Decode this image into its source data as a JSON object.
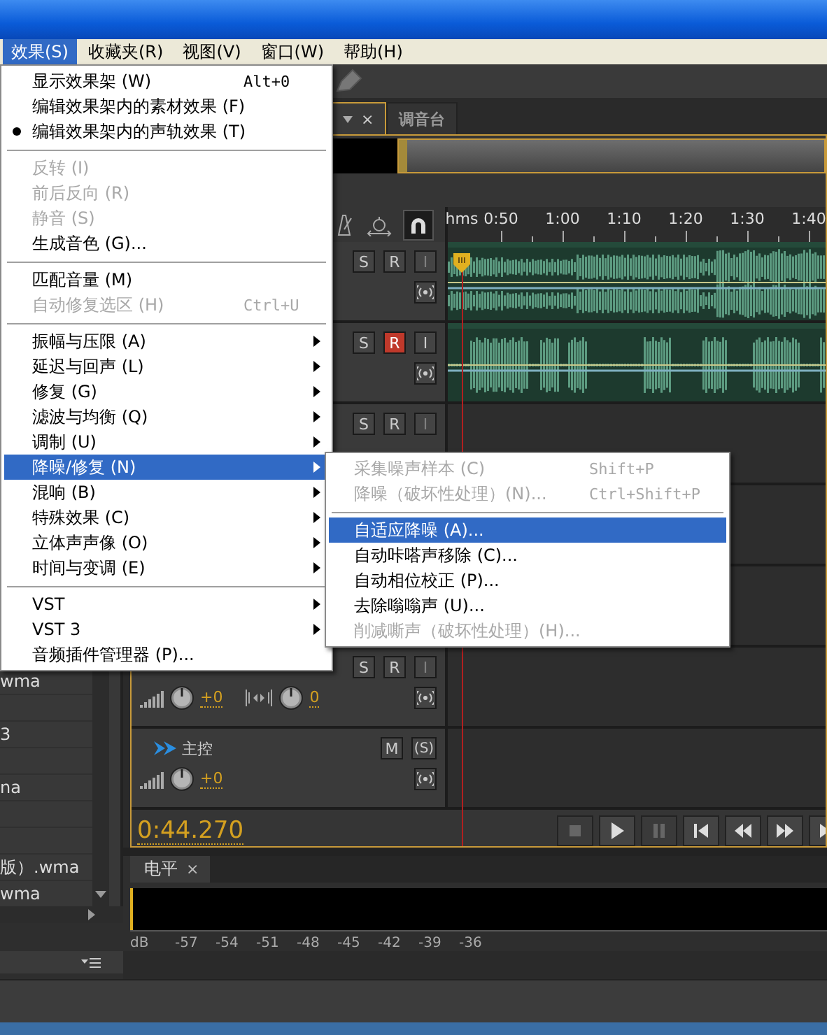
{
  "menubar": [
    {
      "label": "效果(S)",
      "selected": true
    },
    {
      "label": "收藏夹(R)",
      "selected": false
    },
    {
      "label": "视图(V)",
      "selected": false
    },
    {
      "label": "窗口(W)",
      "selected": false
    },
    {
      "label": "帮助(H)",
      "selected": false
    }
  ],
  "effects_menu": {
    "items": [
      {
        "kind": "item",
        "label": "显示效果架 (W)",
        "shortcut": "Alt+0",
        "checked": false,
        "disabled": false,
        "submenu": false,
        "selected": false
      },
      {
        "kind": "item",
        "label": "编辑效果架内的素材效果 (F)",
        "checked": false,
        "disabled": false,
        "submenu": false,
        "selected": false
      },
      {
        "kind": "item",
        "label": "编辑效果架内的声轨效果 (T)",
        "checked": true,
        "disabled": false,
        "submenu": false,
        "selected": false
      },
      {
        "kind": "separator"
      },
      {
        "kind": "item",
        "label": "反转 (I)",
        "checked": false,
        "disabled": true,
        "submenu": false,
        "selected": false
      },
      {
        "kind": "item",
        "label": "前后反向 (R)",
        "checked": false,
        "disabled": true,
        "submenu": false,
        "selected": false
      },
      {
        "kind": "item",
        "label": "静音 (S)",
        "checked": false,
        "disabled": true,
        "submenu": false,
        "selected": false
      },
      {
        "kind": "item",
        "label": "生成音色 (G)...",
        "checked": false,
        "disabled": false,
        "submenu": false,
        "selected": false
      },
      {
        "kind": "separator"
      },
      {
        "kind": "item",
        "label": "匹配音量 (M)",
        "checked": false,
        "disabled": false,
        "submenu": false,
        "selected": false
      },
      {
        "kind": "item",
        "label": "自动修复选区 (H)",
        "shortcut": "Ctrl+U",
        "checked": false,
        "disabled": true,
        "submenu": false,
        "selected": false
      },
      {
        "kind": "separator"
      },
      {
        "kind": "item",
        "label": "振幅与压限 (A)",
        "checked": false,
        "disabled": false,
        "submenu": true,
        "selected": false
      },
      {
        "kind": "item",
        "label": "延迟与回声 (L)",
        "checked": false,
        "disabled": false,
        "submenu": true,
        "selected": false
      },
      {
        "kind": "item",
        "label": "修复 (G)",
        "checked": false,
        "disabled": false,
        "submenu": true,
        "selected": false
      },
      {
        "kind": "item",
        "label": "滤波与均衡 (Q)",
        "checked": false,
        "disabled": false,
        "submenu": true,
        "selected": false
      },
      {
        "kind": "item",
        "label": "调制 (U)",
        "checked": false,
        "disabled": false,
        "submenu": true,
        "selected": false
      },
      {
        "kind": "item",
        "label": "降噪/修复 (N)",
        "checked": false,
        "disabled": false,
        "submenu": true,
        "selected": true
      },
      {
        "kind": "item",
        "label": "混响 (B)",
        "checked": false,
        "disabled": false,
        "submenu": true,
        "selected": false
      },
      {
        "kind": "item",
        "label": "特殊效果 (C)",
        "checked": false,
        "disabled": false,
        "submenu": true,
        "selected": false
      },
      {
        "kind": "item",
        "label": "立体声声像 (O)",
        "checked": false,
        "disabled": false,
        "submenu": true,
        "selected": false
      },
      {
        "kind": "item",
        "label": "时间与变调 (E)",
        "checked": false,
        "disabled": false,
        "submenu": true,
        "selected": false
      },
      {
        "kind": "separator"
      },
      {
        "kind": "item",
        "label": "VST",
        "checked": false,
        "disabled": false,
        "submenu": true,
        "selected": false
      },
      {
        "kind": "item",
        "label": "VST 3",
        "checked": false,
        "disabled": false,
        "submenu": true,
        "selected": false
      },
      {
        "kind": "item",
        "label": "音频插件管理器 (P)...",
        "checked": false,
        "disabled": false,
        "submenu": false,
        "selected": false
      }
    ]
  },
  "noise_submenu": {
    "items": [
      {
        "kind": "item",
        "label": "采集噪声样本 (C)",
        "shortcut": "Shift+P",
        "disabled": true,
        "selected": false
      },
      {
        "kind": "item",
        "label": "降噪（破坏性处理）(N)...",
        "shortcut": "Ctrl+Shift+P",
        "disabled": true,
        "selected": false
      },
      {
        "kind": "separator"
      },
      {
        "kind": "item",
        "label": "自适应降噪 (A)...",
        "disabled": false,
        "selected": true
      },
      {
        "kind": "item",
        "label": "自动咔嗒声移除 (C)...",
        "disabled": false,
        "selected": false
      },
      {
        "kind": "item",
        "label": "自动相位校正 (P)...",
        "disabled": false,
        "selected": false
      },
      {
        "kind": "item",
        "label": "去除嗡嗡声 (U)...",
        "disabled": false,
        "selected": false
      },
      {
        "kind": "item",
        "label": "削减嘶声（破坏性处理）(H)...",
        "disabled": true,
        "selected": false
      }
    ]
  },
  "files": [
    {
      "name": "wma"
    },
    {
      "name": "3"
    },
    {
      "name": "na"
    },
    {
      "name": "版）.wma"
    },
    {
      "name": "wma"
    }
  ],
  "editor_tabs": [
    {
      "close": "×",
      "selected": true
    },
    {
      "label": "调音台",
      "selected": false
    }
  ],
  "ruler": {
    "unit": "hms",
    "labels": [
      "0:50",
      "1:00",
      "1:10",
      "1:20",
      "1:30",
      "1:40"
    ]
  },
  "tracks": [
    {
      "kind": "audio",
      "clip": true,
      "output_button": true,
      "buttons": [
        {
          "label": "S",
          "on": false,
          "disabled": false
        },
        {
          "label": "R",
          "on": false,
          "disabled": false
        },
        {
          "label": "I",
          "on": false,
          "disabled": true
        }
      ]
    },
    {
      "kind": "audio",
      "clip": true,
      "output_button": true,
      "buttons": [
        {
          "label": "S",
          "on": false,
          "disabled": false
        },
        {
          "label": "R",
          "on": true,
          "disabled": false
        },
        {
          "label": "I",
          "on": false,
          "disabled": false
        }
      ]
    },
    {
      "kind": "audio",
      "clip": false,
      "output_button": false,
      "buttons": [
        {
          "label": "S",
          "on": false,
          "disabled": false
        },
        {
          "label": "R",
          "on": false,
          "disabled": false
        },
        {
          "label": "I",
          "on": false,
          "disabled": true
        }
      ]
    },
    {
      "kind": "audio",
      "clip": false,
      "output_button": false
    },
    {
      "kind": "audio",
      "clip": false,
      "output_button": false
    },
    {
      "kind": "audio",
      "clip": false,
      "output_button": true,
      "volume": "+0",
      "pan": "0",
      "buttons": [
        {
          "label": "S",
          "on": false,
          "disabled": false
        },
        {
          "label": "R",
          "on": false,
          "disabled": false
        },
        {
          "label": "I",
          "on": false,
          "disabled": true
        }
      ]
    },
    {
      "kind": "master",
      "name": "主控",
      "clip": false,
      "output_button": true,
      "volume": "+0",
      "buttons": [
        {
          "label": "M",
          "on": false,
          "disabled": false
        },
        {
          "label": "(S)",
          "on": false,
          "disabled": false
        }
      ]
    }
  ],
  "time": "0:44.270",
  "transport": [
    {
      "kind": "stop",
      "disabled": true
    },
    {
      "kind": "play",
      "disabled": false
    },
    {
      "kind": "pause",
      "disabled": true
    },
    {
      "kind": "start",
      "disabled": false
    },
    {
      "kind": "rewind",
      "disabled": false
    },
    {
      "kind": "forward",
      "disabled": false
    },
    {
      "kind": "end",
      "disabled": false
    }
  ],
  "levels": {
    "tab": "电平",
    "close": "×",
    "scale": [
      "dB",
      "-57",
      "-54",
      "-51",
      "-48",
      "-45",
      "-42",
      "-39",
      "-36"
    ]
  }
}
